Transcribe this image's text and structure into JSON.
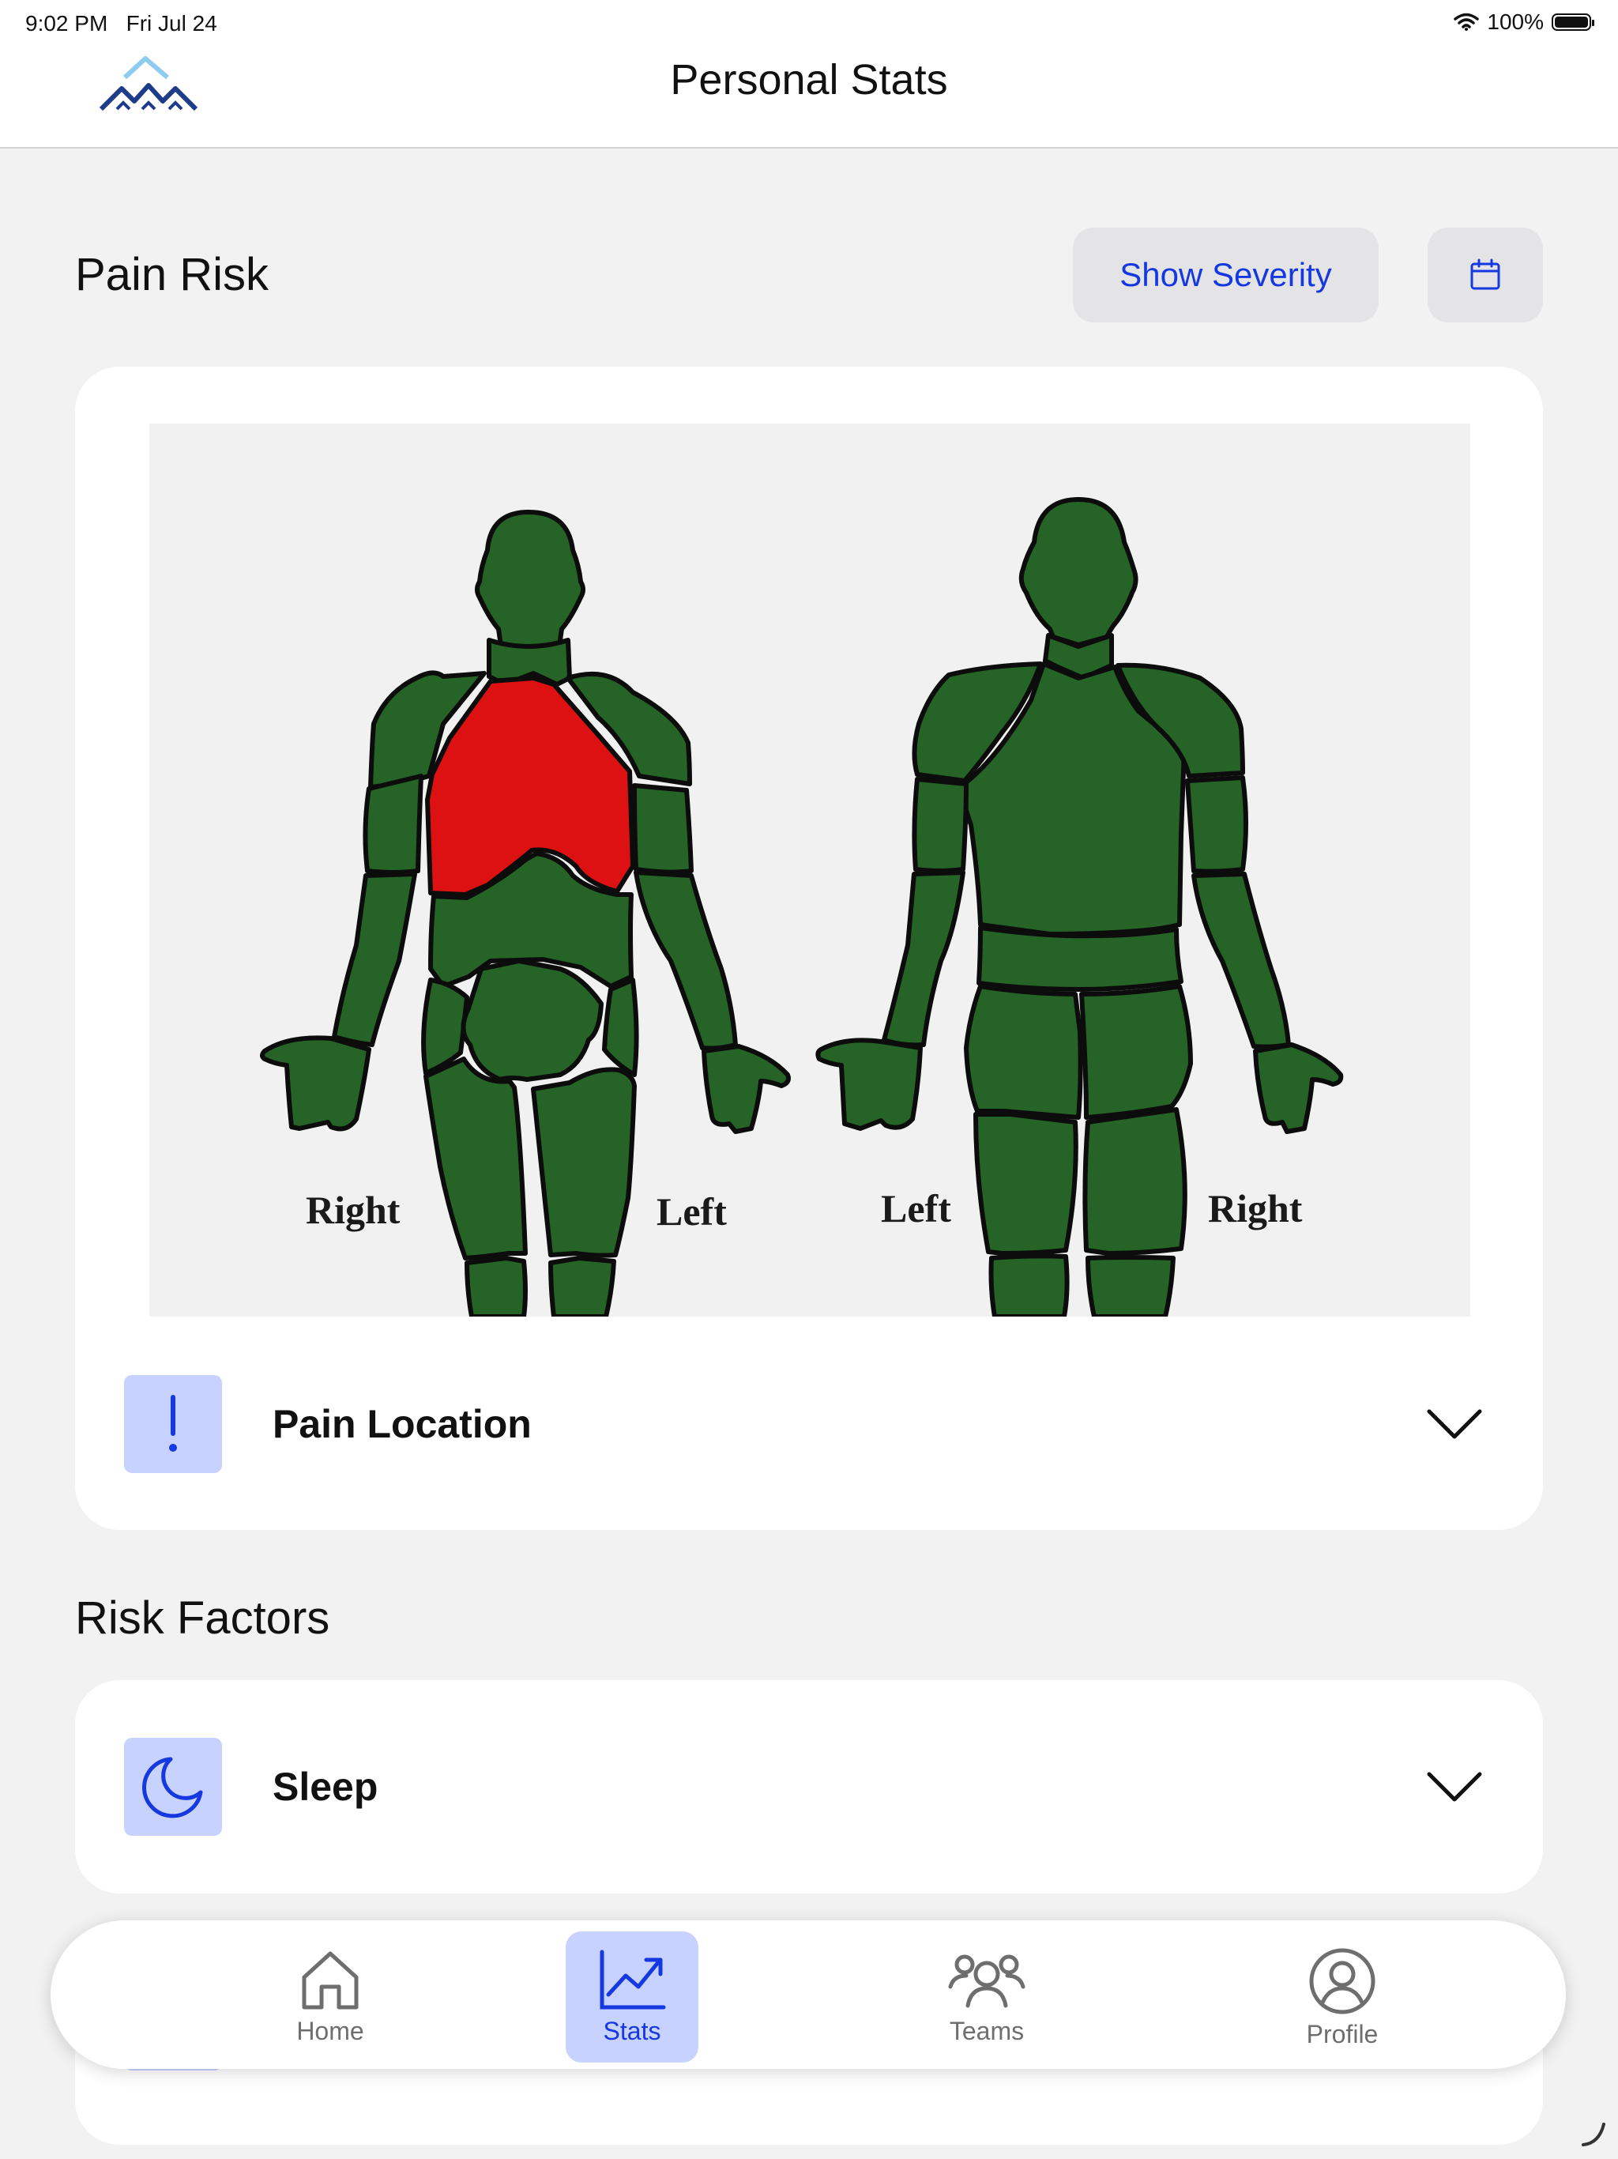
{
  "status_bar": {
    "time": "9:02 PM",
    "date": "Fri Jul 24",
    "battery": "100%"
  },
  "header": {
    "title": "Personal Stats"
  },
  "pain_risk": {
    "title": "Pain Risk",
    "show_severity_label": "Show Severity",
    "calendar_icon": "calendar-icon",
    "figure_labels": {
      "front_right": "Right",
      "front_left": "Left",
      "back_left": "Left",
      "back_right": "Right"
    },
    "highlighted_region": "chest",
    "highlight_color": "#dd1111",
    "body_color": "#256326",
    "pain_location": {
      "label": "Pain Location",
      "icon": "exclamation-icon"
    }
  },
  "risk_factors": {
    "title": "Risk Factors",
    "sleep": {
      "label": "Sleep",
      "icon": "moon-icon"
    }
  },
  "tabs": [
    {
      "label": "Home",
      "icon": "home-icon",
      "active": false
    },
    {
      "label": "Stats",
      "icon": "chart-icon",
      "active": true
    },
    {
      "label": "Teams",
      "icon": "teams-icon",
      "active": false
    },
    {
      "label": "Profile",
      "icon": "profile-icon",
      "active": false
    }
  ],
  "colors": {
    "accent": "#1538e0",
    "accent_light": "#c7d2fe",
    "background": "#f2f2f2"
  }
}
